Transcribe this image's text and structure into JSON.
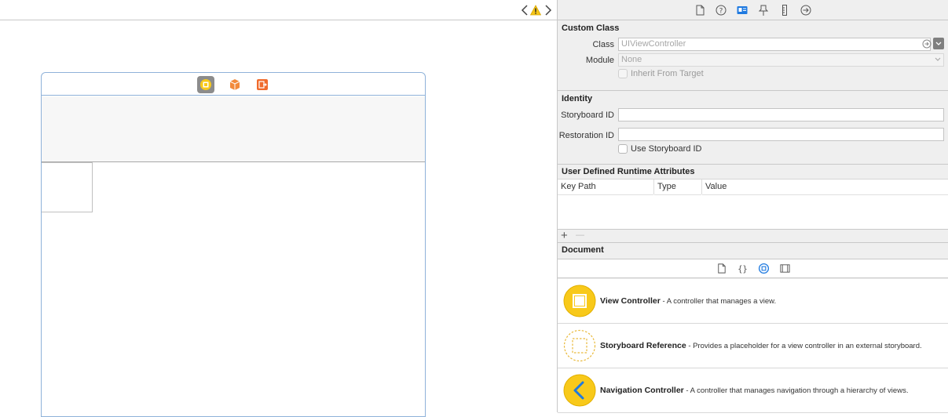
{
  "canvas": {
    "scene_dock_icons": [
      "view-controller-icon",
      "first-responder-icon",
      "exit-icon"
    ]
  },
  "inspector": {
    "tab_icons": [
      "file-icon",
      "quick-help-icon",
      "identity-icon",
      "attributes-icon",
      "size-icon",
      "connections-icon"
    ],
    "custom_class": {
      "title": "Custom Class",
      "class_label": "Class",
      "class_placeholder": "UIViewController",
      "module_label": "Module",
      "module_placeholder": "None",
      "inherit_label": "Inherit From Target"
    },
    "identity": {
      "title": "Identity",
      "storyboard_id_label": "Storyboard ID",
      "restoration_id_label": "Restoration ID",
      "use_storyboard_id_label": "Use Storyboard ID"
    },
    "runtime_attributes": {
      "title": "User Defined Runtime Attributes",
      "columns": [
        "Key Path",
        "Type",
        "Value"
      ],
      "add_label": "+",
      "remove_label": "—"
    },
    "document": {
      "title": "Document"
    }
  },
  "library": {
    "items": [
      {
        "name": "View Controller",
        "description": " - A controller that manages a view."
      },
      {
        "name": "Storyboard Reference",
        "description": " - Provides a placeholder for a view controller in an external storyboard."
      },
      {
        "name": "Navigation Controller",
        "description": " - A controller that manages navigation through a hierarchy of views."
      }
    ]
  },
  "colors": {
    "accent_blue": "#1f7ae0",
    "warning_yellow": "#f5c518",
    "controller_yellow": "#f8c91a",
    "scene_border": "#8fb2d9",
    "exit_orange": "#f06a2b"
  }
}
